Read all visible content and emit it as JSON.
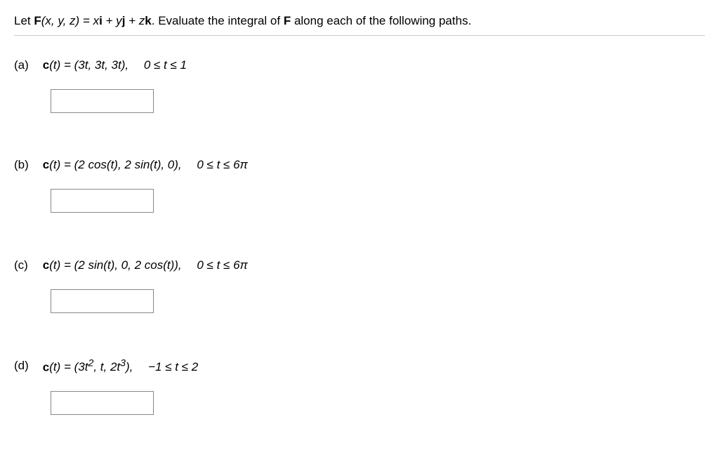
{
  "intro": {
    "pre": "Let ",
    "F": "F",
    "args": "(x, y, z) = x",
    "i": "i",
    "plus1": " + y",
    "j": "j",
    "plus2": " + z",
    "k": "k",
    "post": ". Evaluate the integral of ",
    "F2": "F",
    "tail": " along each of the following paths."
  },
  "parts": {
    "a": {
      "label": "(a)",
      "c": "c",
      "t": "(t) = (3t, 3t, 3t),  0 ≤ t ≤ 1"
    },
    "b": {
      "label": "(b)",
      "c": "c",
      "t": "(t) = (2 cos(t), 2 sin(t), 0),  0 ≤ t ≤ 6π"
    },
    "c": {
      "label": "(c)",
      "c": "c",
      "t": "(t) = (2 sin(t), 0, 2 cos(t)),  0 ≤ t ≤ 6π"
    },
    "d": {
      "label": "(d)",
      "c": "c",
      "t1": "(t) = (3t",
      "sup1": "2",
      "t2": ", t, 2t",
      "sup2": "3",
      "t3": "),  −1 ≤ t ≤ 2"
    }
  }
}
